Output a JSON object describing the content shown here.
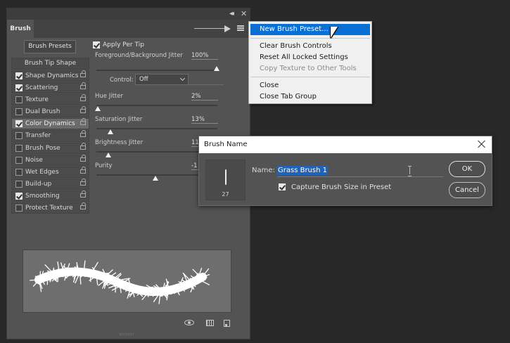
{
  "panel": {
    "tab_label": "Brush",
    "collapse_glyph": "◂◂",
    "close_glyph": "✕",
    "presets_button": "Brush Presets",
    "list_header": "Brush Tip Shape",
    "items": [
      {
        "label": "Shape Dynamics",
        "checked": true
      },
      {
        "label": "Scattering",
        "checked": true
      },
      {
        "label": "Texture",
        "checked": false
      },
      {
        "label": "Dual Brush",
        "checked": false
      },
      {
        "label": "Color Dynamics",
        "checked": true
      },
      {
        "label": "Transfer",
        "checked": false
      },
      {
        "label": "Brush Pose",
        "checked": false
      },
      {
        "label": "Noise",
        "checked": false
      },
      {
        "label": "Wet Edges",
        "checked": false
      },
      {
        "label": "Build-up",
        "checked": false
      },
      {
        "label": "Smoothing",
        "checked": true
      },
      {
        "label": "Protect Texture",
        "checked": false
      }
    ],
    "selected_item": "Color Dynamics",
    "apply_per_tip": {
      "label": "Apply Per Tip",
      "checked": true
    },
    "fg_bg_jitter": {
      "label": "Foreground/Background Jitter",
      "value": "100%"
    },
    "control": {
      "label": "Control:",
      "value": "Off"
    },
    "hue_jitter": {
      "label": "Hue Jitter",
      "value": "2%"
    },
    "saturation_jitter": {
      "label": "Saturation Jitter",
      "value": "13%"
    },
    "brightness_jitter": {
      "label": "Brightness Jitter",
      "value": "11"
    },
    "purity": {
      "label": "Purity",
      "value": "-1"
    }
  },
  "menu": {
    "items": [
      {
        "label": "New Brush Preset...",
        "state": "active"
      },
      {
        "label": "Clear Brush Controls",
        "state": "normal"
      },
      {
        "label": "Reset All Locked Settings",
        "state": "normal"
      },
      {
        "label": "Copy Texture to Other Tools",
        "state": "disabled"
      },
      {
        "label": "Close",
        "state": "normal"
      },
      {
        "label": "Close Tab Group",
        "state": "normal"
      }
    ]
  },
  "dialog": {
    "title": "Brush Name",
    "name_label": "Name:",
    "name_value": "Grass Brush 1",
    "tip_size": "27",
    "capture": {
      "label": "Capture Brush Size in Preset",
      "checked": true
    },
    "ok_label": "OK",
    "cancel_label": "Cancel"
  },
  "colors": {
    "panel_bg": "#535353",
    "menu_highlight": "#0a6fd4",
    "selection": "#1e63b8",
    "preview_bg": "#6e6e6e"
  }
}
